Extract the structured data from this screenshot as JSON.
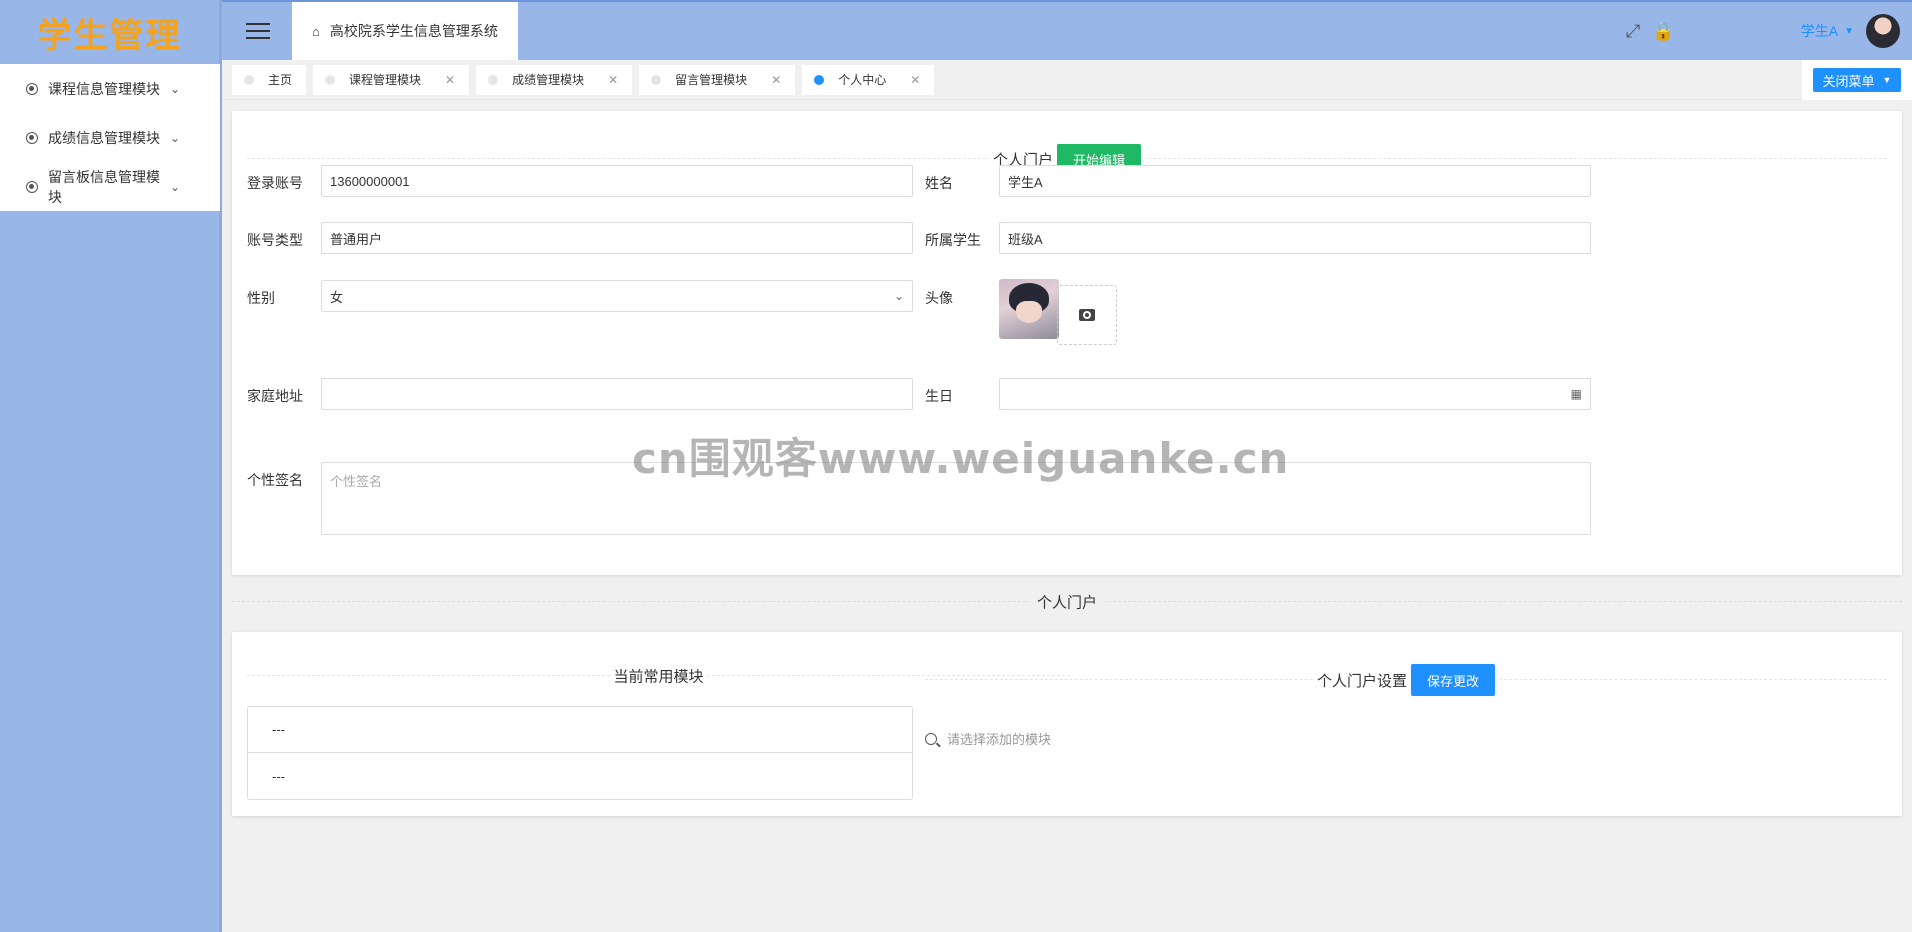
{
  "app": {
    "logo": "学生管理",
    "system_title": "高校院系学生信息管理系统"
  },
  "sidebar": {
    "items": [
      {
        "label": "课程信息管理模块"
      },
      {
        "label": "成绩信息管理模块"
      },
      {
        "label": "留言板信息管理模块"
      }
    ]
  },
  "header": {
    "user_name": "学生A"
  },
  "tabs": [
    {
      "label": "主页",
      "closable": false
    },
    {
      "label": "课程管理模块",
      "closable": true
    },
    {
      "label": "成绩管理模块",
      "closable": true
    },
    {
      "label": "留言管理模块",
      "closable": true
    },
    {
      "label": "个人中心",
      "closable": true,
      "active": true
    }
  ],
  "tabbar": {
    "close_menu_label": "关闭菜单"
  },
  "profile": {
    "section_title": "个人门户",
    "edit_button": "开始编辑",
    "fields": {
      "account": {
        "label": "登录账号",
        "value": "13600000001"
      },
      "name": {
        "label": "姓名",
        "value": "学生A"
      },
      "account_type": {
        "label": "账号类型",
        "value": "普通用户"
      },
      "student_of": {
        "label": "所属学生",
        "value": "班级A"
      },
      "gender": {
        "label": "性别",
        "value": "女"
      },
      "avatar": {
        "label": "头像"
      },
      "address": {
        "label": "家庭地址",
        "value": ""
      },
      "birthday": {
        "label": "生日",
        "value": ""
      },
      "signature": {
        "label": "个性签名",
        "placeholder": "个性签名"
      }
    }
  },
  "portal": {
    "section_title": "个人门户",
    "common_modules_title": "当前常用模块",
    "common_modules": [
      "---",
      "---"
    ],
    "settings_title": "个人门户设置",
    "save_button": "保存更改",
    "search_placeholder": "请选择添加的模块"
  },
  "watermark": "cn围观客www.weiguanke.cn",
  "colors": {
    "accent": "#1e90ff",
    "sidebar_bg": "#98b6e8",
    "edit_green": "#1fb864",
    "logo": "#f7a21b"
  }
}
